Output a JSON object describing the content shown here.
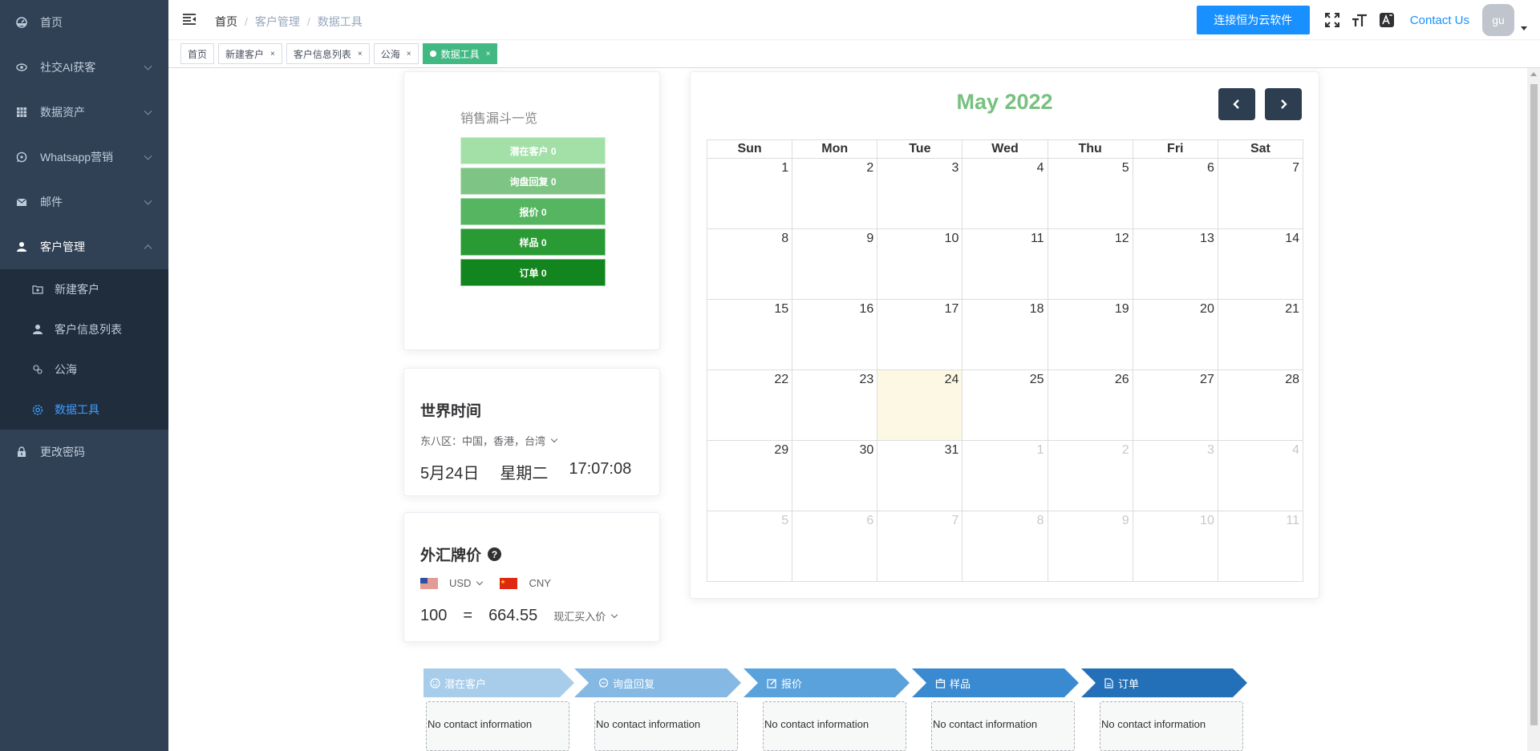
{
  "sidebar": {
    "items": [
      {
        "label": "首页",
        "icon": "dashboard-icon"
      },
      {
        "label": "社交AI获客",
        "icon": "eye-icon"
      },
      {
        "label": "数据资产",
        "icon": "table-icon"
      },
      {
        "label": "Whatsapp营销",
        "icon": "whatsapp-icon"
      },
      {
        "label": "邮件",
        "icon": "mail-icon"
      },
      {
        "label": "客户管理",
        "icon": "user-icon"
      }
    ],
    "submenu": [
      {
        "label": "新建客户",
        "icon": "folder-add-icon"
      },
      {
        "label": "客户信息列表",
        "icon": "user-icon"
      },
      {
        "label": "公海",
        "icon": "sea-icon"
      },
      {
        "label": "数据工具",
        "icon": "gear-icon"
      }
    ],
    "bottom": {
      "label": "更改密码",
      "icon": "lock-icon"
    }
  },
  "navbar": {
    "breadcrumb": [
      "首页",
      "客户管理",
      "数据工具"
    ],
    "connect_button": "连接恒为云软件",
    "contact": "Contact Us",
    "avatar": "gu"
  },
  "tags": [
    {
      "label": "首页",
      "closable": false,
      "active": false
    },
    {
      "label": "新建客户",
      "closable": true,
      "active": false
    },
    {
      "label": "客户信息列表",
      "closable": true,
      "active": false
    },
    {
      "label": "公海",
      "closable": true,
      "active": false
    },
    {
      "label": "数据工具",
      "closable": true,
      "active": true
    }
  ],
  "tag_close": "×",
  "funnel": {
    "title": "销售漏斗一览",
    "stages": [
      {
        "label": "潜在客户 0",
        "color": "#a3e0a8"
      },
      {
        "label": "询盘回复 0",
        "color": "#7ec585"
      },
      {
        "label": "报价 0",
        "color": "#56b560"
      },
      {
        "label": "样品 0",
        "color": "#2a9b34"
      },
      {
        "label": "订单 0",
        "color": "#12851e"
      }
    ]
  },
  "world_time": {
    "title": "世界时间",
    "zone": "东八区：中国，香港，台湾",
    "date": "5月24日",
    "weekday": "星期二",
    "time": "17:07:08"
  },
  "forex": {
    "title": "外汇牌价",
    "help": "?",
    "from": "USD",
    "to": "CNY",
    "amount": "100",
    "equals": "=",
    "result": "664.55",
    "rate_type": "现汇买入价"
  },
  "calendar": {
    "month": "May 2022",
    "weekdays": [
      "Sun",
      "Mon",
      "Tue",
      "Wed",
      "Thu",
      "Fri",
      "Sat"
    ],
    "weeks": [
      [
        "1",
        "2",
        "3",
        "4",
        "5",
        "6",
        "7"
      ],
      [
        "8",
        "9",
        "10",
        "11",
        "12",
        "13",
        "14"
      ],
      [
        "15",
        "16",
        "17",
        "18",
        "19",
        "20",
        "21"
      ],
      [
        "22",
        "23",
        "24",
        "25",
        "26",
        "27",
        "28"
      ],
      [
        "29",
        "30",
        "31",
        "1",
        "2",
        "3",
        "4"
      ],
      [
        "5",
        "6",
        "7",
        "8",
        "9",
        "10",
        "11"
      ]
    ],
    "today": "24"
  },
  "pipeline": [
    {
      "label": "潜在客户",
      "icon": "smile-icon",
      "color": "#a8cdeb",
      "empty": "No contact information"
    },
    {
      "label": "询盘回复",
      "icon": "chat-icon",
      "color": "#85b9e4",
      "empty": "No contact information"
    },
    {
      "label": "报价",
      "icon": "edit-icon",
      "color": "#5aa2dc",
      "empty": "No contact information"
    },
    {
      "label": "样品",
      "icon": "box-icon",
      "color": "#3a8ad1",
      "empty": "No contact information"
    },
    {
      "label": "订单",
      "icon": "document-icon",
      "color": "#2470b8",
      "empty": "No contact information"
    }
  ]
}
